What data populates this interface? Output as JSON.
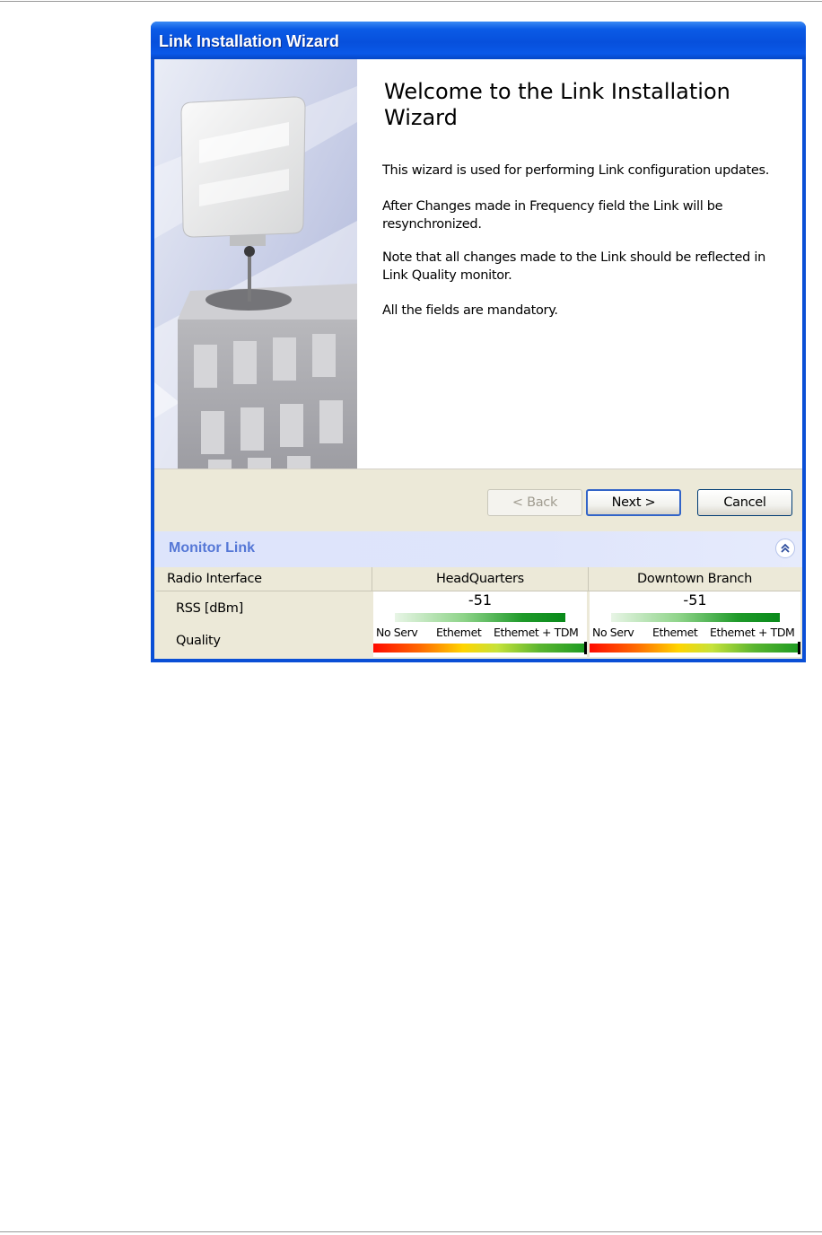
{
  "window": {
    "title": "Link Installation Wizard"
  },
  "wizard": {
    "heading": "Welcome to the Link Installation Wizard",
    "paragraphs": [
      "This wizard is used for performing Link configuration updates.",
      "After Changes made in Frequency field the Link will be resynchronized.",
      "Note that all changes made to the Link should be reflected in Link Quality monitor.",
      "All the fields are mandatory."
    ]
  },
  "buttons": {
    "back": "< Back",
    "next": "Next >",
    "cancel": "Cancel"
  },
  "monitor": {
    "title": "Monitor Link",
    "collapse_icon": "double-chevron-up-icon",
    "columns": {
      "label": "Radio Interface",
      "site_a": "HeadQuarters",
      "site_b": "Downtown Branch"
    },
    "rows": {
      "rss": "RSS [dBm]",
      "quality": "Quality"
    },
    "site_a": {
      "rss": "-51",
      "rss_level": 0.8,
      "quality_labels": [
        "No Serv",
        "Ethemet",
        "Ethemet + TDM"
      ],
      "quality_level": 1.0
    },
    "site_b": {
      "rss": "-51",
      "rss_level": 0.8,
      "quality_labels": [
        "No Serv",
        "Ethemet",
        "Ethemet + TDM"
      ],
      "quality_level": 1.0
    }
  },
  "colors": {
    "titlebar": "#0a4fd6",
    "monitor_title": "#5577d6",
    "rss_bar": "#098a1a"
  }
}
